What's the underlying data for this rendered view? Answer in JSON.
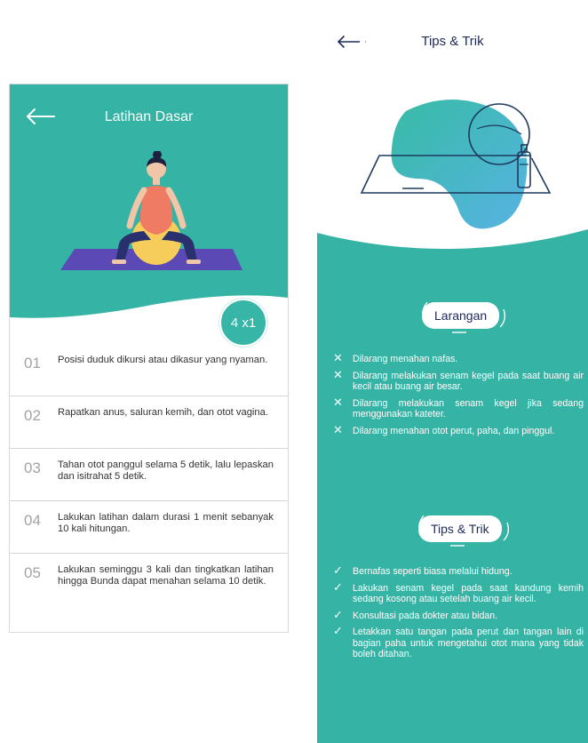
{
  "left_screen": {
    "title": "Latihan Dasar",
    "count_badge": "4 x1",
    "colors": {
      "header": "#35b3a4",
      "mat": "#5b49b6",
      "ball": "#f6cd5a"
    },
    "steps": [
      {
        "num": "01",
        "text": "Posisi duduk dikursi atau dikasur yang nyaman."
      },
      {
        "num": "02",
        "text": "Rapatkan anus, saluran kemih, dan otot vagina."
      },
      {
        "num": "03",
        "text": "Tahan otot panggul selama 5 detik, lalu lepaskan dan isitrahat 5 detik."
      },
      {
        "num": "04",
        "text": "Lakukan latihan dalam durasi 1 menit sebanyak 10 kali hitungan."
      },
      {
        "num": "05",
        "text": "Lakukan seminggu 3 kali dan tingkatkan latihan hingga Bunda dapat menahan selama 10 detik."
      }
    ]
  },
  "right_screen": {
    "title": "Tips & Trik",
    "colors": {
      "section": "#35b3a4",
      "title": "#1e2a57"
    },
    "larangan": {
      "label": "Larangan",
      "icon": "x-icon",
      "items": [
        "Dilarang menahan nafas.",
        "Dilarang melakukan senam kegel pada saat buang air kecil atau buang air besar.",
        "Dilarang melakukan senam kegel jika sedang menggunakan kateter.",
        "Dilarang menahan otot perut, paha, dan pinggul."
      ]
    },
    "tips": {
      "label": "Tips & Trik",
      "icon": "check-icon",
      "items": [
        "Bernafas seperti biasa melalui hidung.",
        "Lakukan senam kegel pada saat kandung kemih sedang kosong atau setelah buang air kecil.",
        "Konsultasi pada dokter atau bidan.",
        "Letakkan satu tangan pada perut dan tangan lain di bagian paha untuk mengetahui otot mana yang tidak boleh ditahan."
      ]
    }
  }
}
